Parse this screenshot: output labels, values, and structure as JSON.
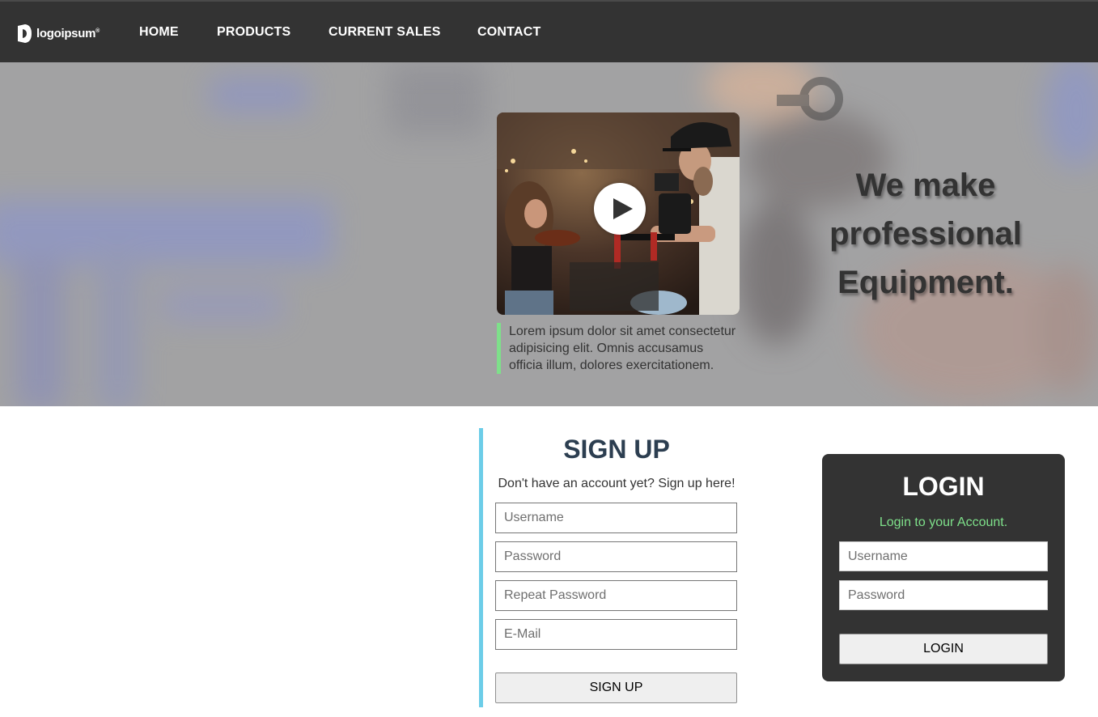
{
  "brand": {
    "logo_text": "logoipsum",
    "logo_mark": "®"
  },
  "nav": {
    "items": [
      {
        "label": "HOME"
      },
      {
        "label": "PRODUCTS"
      },
      {
        "label": "CURRENT SALES"
      },
      {
        "label": "CONTACT"
      }
    ]
  },
  "hero": {
    "title_line1": "We make",
    "title_line2": "professional",
    "title_line3": "Equipment.",
    "quote": "Lorem ipsum dolor sit amet consectetur adipisicing elit. Omnis accusamus officia illum, dolores exercitationem.",
    "video_icon": "play-icon"
  },
  "signup": {
    "title": "SIGN UP",
    "subtitle": "Don't have an account yet? Sign up here!",
    "username_placeholder": "Username",
    "password_placeholder": "Password",
    "repeat_password_placeholder": "Repeat Password",
    "email_placeholder": "E-Mail",
    "button_label": "SIGN UP"
  },
  "login": {
    "title": "LOGIN",
    "subtitle": "Login to your Account.",
    "username_placeholder": "Username",
    "password_placeholder": "Password",
    "button_label": "LOGIN"
  },
  "colors": {
    "nav_bg": "#333333",
    "accent_green": "#7ee08a",
    "accent_blue": "#6ccde8",
    "heading_dark": "#2c3e50"
  }
}
